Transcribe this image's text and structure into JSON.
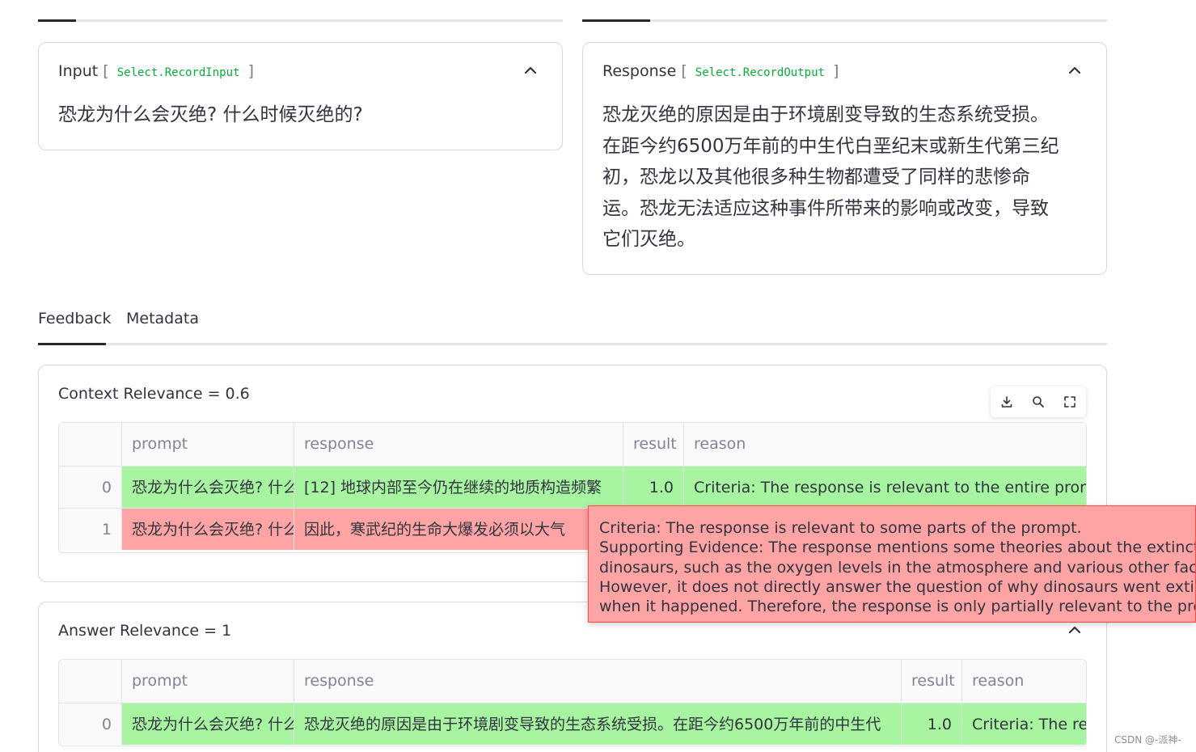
{
  "input_card": {
    "label": "Input",
    "open_bracket": "[",
    "code": "Select.RecordInput",
    "close_bracket": "]",
    "text": "恐龙为什么会灭绝? 什么时候灭绝的?"
  },
  "response_card": {
    "label": "Response",
    "open_bracket": "[",
    "code": "Select.RecordOutput",
    "close_bracket": "]",
    "lines": [
      "恐龙灭绝的原因是由于环境剧变导致的生态系统受损。",
      "在距今约6500万年前的中生代白垩纪末或新生代第三纪",
      "初，恐龙以及其他很多种生物都遭受了同样的悲惨命",
      "运。恐龙无法适应这种事件所带来的影响或改变，导致",
      "它们灭绝。"
    ]
  },
  "tabs": {
    "feedback": "Feedback",
    "metadata": "Metadata",
    "active": "Feedback"
  },
  "context_relevance": {
    "title": "Context Relevance = 0.6",
    "columns": [
      "",
      "prompt",
      "response",
      "result",
      "reason"
    ],
    "rows": [
      {
        "index": "0",
        "prompt": "恐龙为什么会灭绝? 什么时候灭绝的?",
        "response": "[12] 地球内部至今仍在继续的地质构造频繁",
        "result": "1.0",
        "reason": "Criteria: The response is relevant to the entire prompt and",
        "status": "pass"
      },
      {
        "index": "1",
        "prompt": "恐龙为什么会灭绝? 什么时候灭绝的?",
        "response": "因此，寒武纪的生命大爆发必须以大气",
        "result": "",
        "reason": "",
        "status": "fail"
      }
    ]
  },
  "tooltip": {
    "lines": [
      "Criteria: The response is relevant to some parts of the prompt.",
      "Supporting Evidence: The response mentions some theories about the extinction of",
      "dinosaurs, such as the oxygen levels in the atmosphere and various other factors.",
      "However, it does not directly answer the question of why dinosaurs went extinct or",
      "when it happened. Therefore, the response is only partially relevant to the prompt."
    ]
  },
  "answer_relevance": {
    "title": "Answer Relevance = 1",
    "columns": [
      "",
      "prompt",
      "response",
      "result",
      "reason"
    ],
    "rows": [
      {
        "index": "0",
        "prompt": "恐龙为什么会灭绝? 什么时候灭绝的?",
        "response": "恐龙灭绝的原因是由于环境剧变导致的生态系统受损。在距今约6500万年前的中生代",
        "result": "1.0",
        "reason": "Criteria: The response",
        "status": "pass"
      }
    ]
  },
  "icons": {
    "chevron": "chevron-up-icon",
    "download": "download-icon",
    "search": "search-icon",
    "fullscreen": "fullscreen-icon"
  },
  "colors": {
    "pass": "#a8f5a1",
    "fail": "#ffa4a4",
    "accent_code": "#09ab3b"
  },
  "watermark": "CSDN @-派神-"
}
